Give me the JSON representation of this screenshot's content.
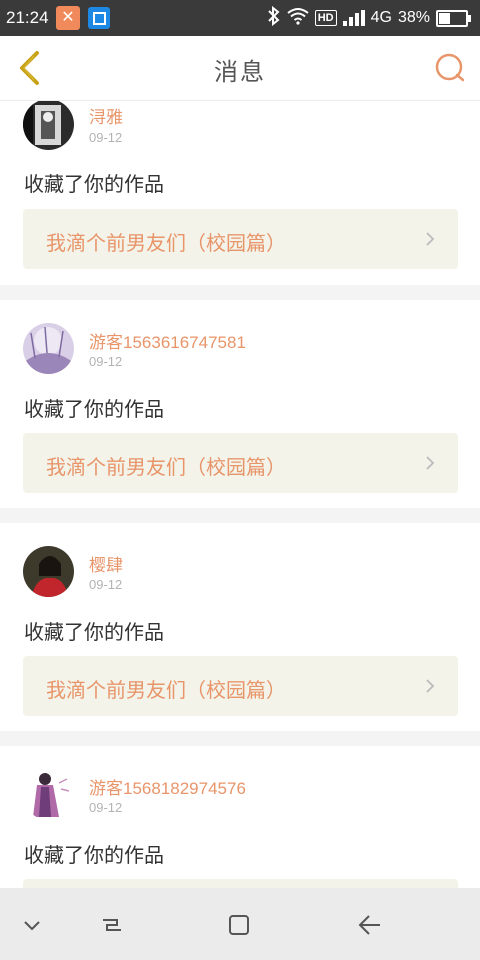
{
  "status_bar": {
    "time": "21:24",
    "network": "4G",
    "battery": "38%",
    "hd_label": "HD",
    "battery_level": 0.38
  },
  "header": {
    "title": "消息"
  },
  "messages": [
    {
      "username": "浔雅",
      "date": "09-12",
      "action": "收藏了你的作品",
      "work_title": "我滴个前男友们（校园篇）"
    },
    {
      "username": "游客1563616747581",
      "date": "09-12",
      "action": "收藏了你的作品",
      "work_title": "我滴个前男友们（校园篇）"
    },
    {
      "username": "樱肆",
      "date": "09-12",
      "action": "收藏了你的作品",
      "work_title": "我滴个前男友们（校园篇）"
    },
    {
      "username": "游客1568182974576",
      "date": "09-12",
      "action": "收藏了你的作品",
      "work_title": ""
    }
  ],
  "icons": {
    "back": "chevron-left-icon",
    "search": "search-icon",
    "nav": [
      "chevron-down-icon",
      "recent-apps-icon",
      "home-icon",
      "back-arrow-icon"
    ]
  },
  "colors": {
    "accent": "#e8956a",
    "back_icon": "#c9a317",
    "card_link_bg": "#f3f3ea"
  }
}
